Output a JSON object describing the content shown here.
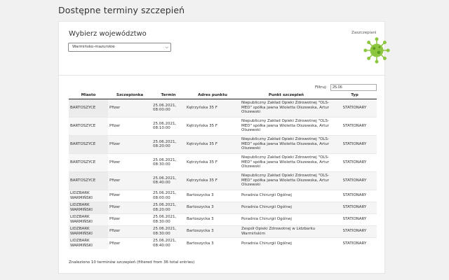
{
  "page": {
    "title": "Dostępne terminy szczepień"
  },
  "selector": {
    "heading": "Wybierz województwo",
    "selected": "Warmińsko-mazurskie",
    "vaccinated_label": "Zaszczepiani"
  },
  "filter": {
    "label": "Filtruj:",
    "value": "25.06"
  },
  "table": {
    "columns": [
      "Miasto",
      "Szczepionka",
      "Termin",
      "Adres punktu",
      "Punkt szczepień",
      "Typ"
    ],
    "rows": [
      {
        "city": "BARTOSZYCE",
        "vaccine": "Pfizer",
        "date": "25.06.2021, 08:00:00",
        "address": "Kętrzyńska 35 F",
        "point": "Niepubliczny Zakład Opieki Zdrowotnej \"OLS-MED\" spółka jawna Wioletta Olszewska, Artur Olszewski",
        "type": "STATIONARY"
      },
      {
        "city": "BARTOSZYCE",
        "vaccine": "Pfizer",
        "date": "25.06.2021, 08:10:00",
        "address": "Kętrzyńska 35 F",
        "point": "Niepubliczny Zakład Opieki Zdrowotnej \"OLS-MED\" spółka jawna Wioletta Olszewska, Artur Olszewski",
        "type": "STATIONARY"
      },
      {
        "city": "BARTOSZYCE",
        "vaccine": "Pfizer",
        "date": "25.06.2021, 08:20:00",
        "address": "Kętrzyńska 35 F",
        "point": "Niepubliczny Zakład Opieki Zdrowotnej \"OLS-MED\" spółka jawna Wioletta Olszewska, Artur Olszewski",
        "type": "STATIONARY"
      },
      {
        "city": "BARTOSZYCE",
        "vaccine": "Pfizer",
        "date": "25.06.2021, 08:30:00",
        "address": "Kętrzyńska 35 F",
        "point": "Niepubliczny Zakład Opieki Zdrowotnej \"OLS-MED\" spółka jawna Wioletta Olszewska, Artur Olszewski",
        "type": "STATIONARY"
      },
      {
        "city": "BARTOSZYCE",
        "vaccine": "Pfizer",
        "date": "25.06.2021, 08:40:00",
        "address": "Kętrzyńska 35 F",
        "point": "Niepubliczny Zakład Opieki Zdrowotnej \"OLS-MED\" spółka jawna Wioletta Olszewska, Artur Olszewski",
        "type": "STATIONARY"
      },
      {
        "city": "LIDZBARK WARMIŃSKI",
        "vaccine": "Pfizer",
        "date": "25.06.2021, 08:00:00",
        "address": "Bartoszycka 3",
        "point": "Poradnia Chirurgii Ogólnej",
        "type": "STATIONARY"
      },
      {
        "city": "LIDZBARK WARMIŃSKI",
        "vaccine": "Pfizer",
        "date": "25.06.2021, 08:20:00",
        "address": "Bartoszycka 3",
        "point": "Poradnia Chirurgii Ogólnej",
        "type": "STATIONARY"
      },
      {
        "city": "LIDZBARK WARMIŃSKI",
        "vaccine": "Pfizer",
        "date": "25.06.2021, 08:30:00",
        "address": "Bartoszycka 3",
        "point": "Poradnia Chirurgii Ogólnej",
        "type": "STATIONARY"
      },
      {
        "city": "LIDZBARK WARMIŃSKI",
        "vaccine": "Pfizer",
        "date": "25.06.2021, 08:30:00",
        "address": "Bartoszycka 3",
        "point": "Zespół Opieki Zdrowotnej w Lidzbarku Warmińskim",
        "type": "STATIONARY"
      },
      {
        "city": "LIDZBARK WARMIŃSKI",
        "vaccine": "Pfizer",
        "date": "25.06.2021, 08:40:00",
        "address": "Bartoszycka 3",
        "point": "Poradnia Chirurgii Ogólnej",
        "type": "STATIONARY"
      }
    ]
  },
  "info": "Znaleziono 10 terminów szczepień (filtered from 36 total entries)",
  "colors": {
    "virus": "#8dc63f",
    "virus_dark": "#5a9a1f"
  }
}
